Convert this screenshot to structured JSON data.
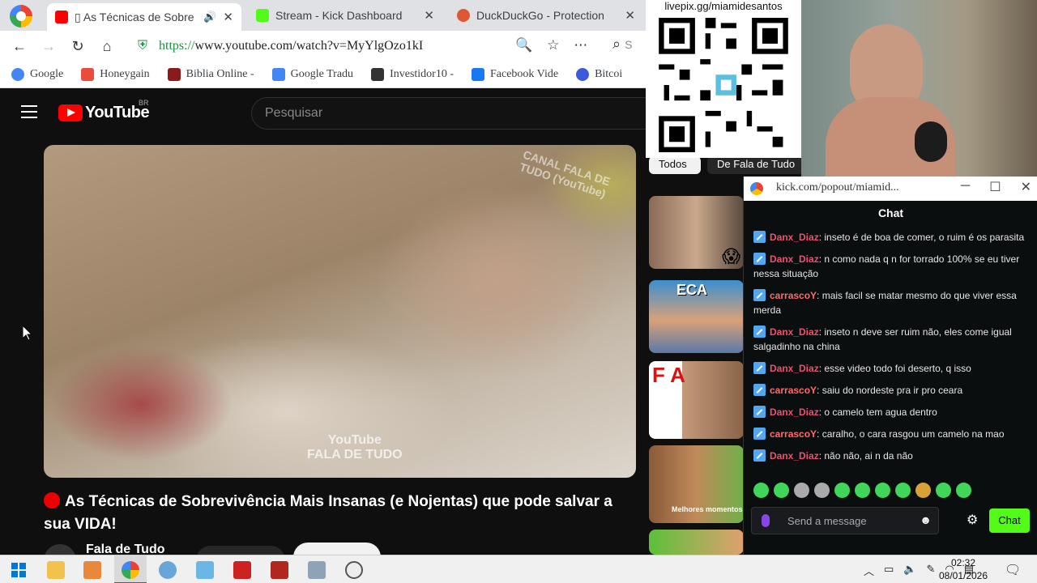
{
  "browser": {
    "tabs": [
      {
        "title": "▯ As Técnicas de Sobre",
        "color": "#ff0000"
      },
      {
        "title": "Stream - Kick Dashboard",
        "color": "#53fc18"
      },
      {
        "title": "DuckDuckGo - Protection",
        "color": "#de5833"
      }
    ],
    "url_scheme": "https://",
    "url_rest": "www.youtube.com/watch?v=MyYlgOzo1kI",
    "search_right_label": "S",
    "bookmarks": [
      {
        "label": "Google",
        "color": "#4285f4"
      },
      {
        "label": "Honeygain",
        "color": "#e94b3c"
      },
      {
        "label": "Biblia Online -",
        "color": "#8b1a1a"
      },
      {
        "label": "Google Tradu",
        "color": "#4285f4"
      },
      {
        "label": "Investidor10 -",
        "color": "#333333"
      },
      {
        "label": "Facebook Vide",
        "color": "#1877f2"
      },
      {
        "label": "Bitcoi",
        "color": "#3b5bdb"
      }
    ]
  },
  "youtube": {
    "logo_word": "YouTube",
    "region": "BR",
    "search_placeholder": "Pesquisar",
    "watermark_top": "CANAL FALA DE TUDO (YouTube)",
    "watermark_bottom_1": "YouTube",
    "watermark_bottom_2": "FALA DE TUDO",
    "video_title": "As Técnicas de Sobrevivência Mais Insanas (e Nojentas) que pode salvar a sua VIDA!",
    "channel_name": "Fala de Tudo",
    "chips": [
      "Todos",
      "De Fala de Tudo"
    ],
    "thumb_texts": [
      "ECA",
      "F A",
      "Melhores momentos"
    ]
  },
  "overlay": {
    "qr_label": "livepix.gg/miamidesantos"
  },
  "popout": {
    "url": "kick.com/popout/miamid...",
    "header": "Chat",
    "messages": [
      {
        "user": "Danx_Diaz",
        "color": "#f0506e",
        "text": "inseto é de boa de comer, o ruim é os parasita"
      },
      {
        "user": "Danx_Diaz",
        "color": "#f0506e",
        "text": "n como nada q n for torrado 100% se eu tiver nessa situação"
      },
      {
        "user": "carrascoY",
        "color": "#ff6b6b",
        "text": "mais facil se matar mesmo do que viver essa merda"
      },
      {
        "user": "Danx_Diaz",
        "color": "#f0506e",
        "text": "inseto n deve ser ruim não, eles come igual salgadinho na china"
      },
      {
        "user": "Danx_Diaz",
        "color": "#f0506e",
        "text": "esse video todo foi deserto, q isso"
      },
      {
        "user": "carrascoY",
        "color": "#ff6b6b",
        "text": "saiu do nordeste pra ir pro ceara"
      },
      {
        "user": "Danx_Diaz",
        "color": "#f0506e",
        "text": "o camelo tem agua dentro"
      },
      {
        "user": "carrascoY",
        "color": "#ff6b6b",
        "text": "caralho, o cara rasgou um camelo na mao"
      },
      {
        "user": "Danx_Diaz",
        "color": "#f0506e",
        "text": "não não, ai n da não"
      }
    ],
    "send_placeholder": "Send a message",
    "chat_button": "Chat"
  },
  "taskbar": {
    "time": "02:32",
    "date": "08/01/2026"
  }
}
